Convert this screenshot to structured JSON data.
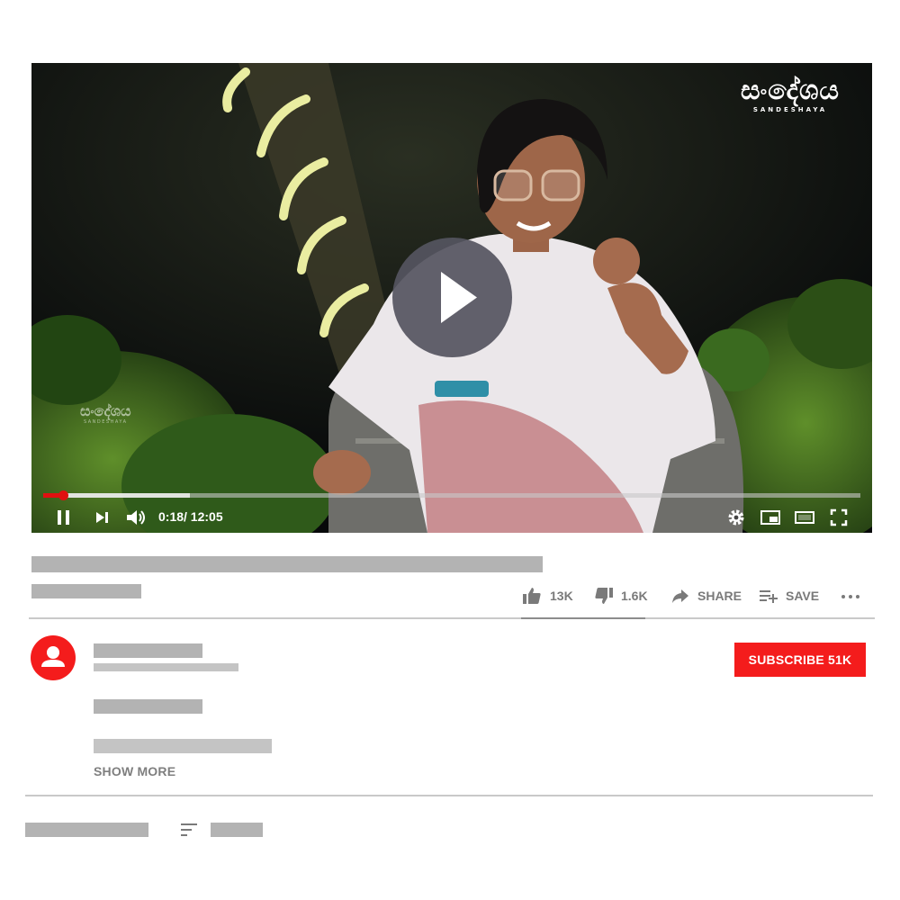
{
  "video": {
    "channel_logo": "සංදේශය",
    "channel_logo_sub": "SANDESHAYA",
    "watermark_logo": "සංදේශය",
    "watermark_logo_sub": "SANDESHAYA",
    "progress_played_fraction": 0.025,
    "progress_buffered_fraction": 0.18,
    "time_current": "0:18",
    "time_total": "/ 12:05",
    "icons": {
      "play": "play-icon",
      "pause": "pause-icon",
      "next": "skip-next-icon",
      "volume": "volume-icon",
      "settings": "gear-icon",
      "miniplayer": "miniplayer-icon",
      "theater": "theater-mode-icon",
      "fullscreen": "fullscreen-icon"
    }
  },
  "actions": {
    "like_count": "13K",
    "dislike_count": "1.6K",
    "share_label": "SHARE",
    "save_label": "SAVE",
    "more_icon": "more-horizontal-icon"
  },
  "channel": {
    "avatar_icon": "person-icon",
    "subscribe_label": "SUBSCRIBE 51K"
  },
  "description": {
    "show_more_label": "SHOW MORE"
  },
  "comments": {
    "sort_icon": "sort-icon"
  },
  "colors": {
    "accent_red": "#f41c1c",
    "placeholder_gray": "#b3b3b3",
    "text_gray": "#7a7a7a"
  }
}
